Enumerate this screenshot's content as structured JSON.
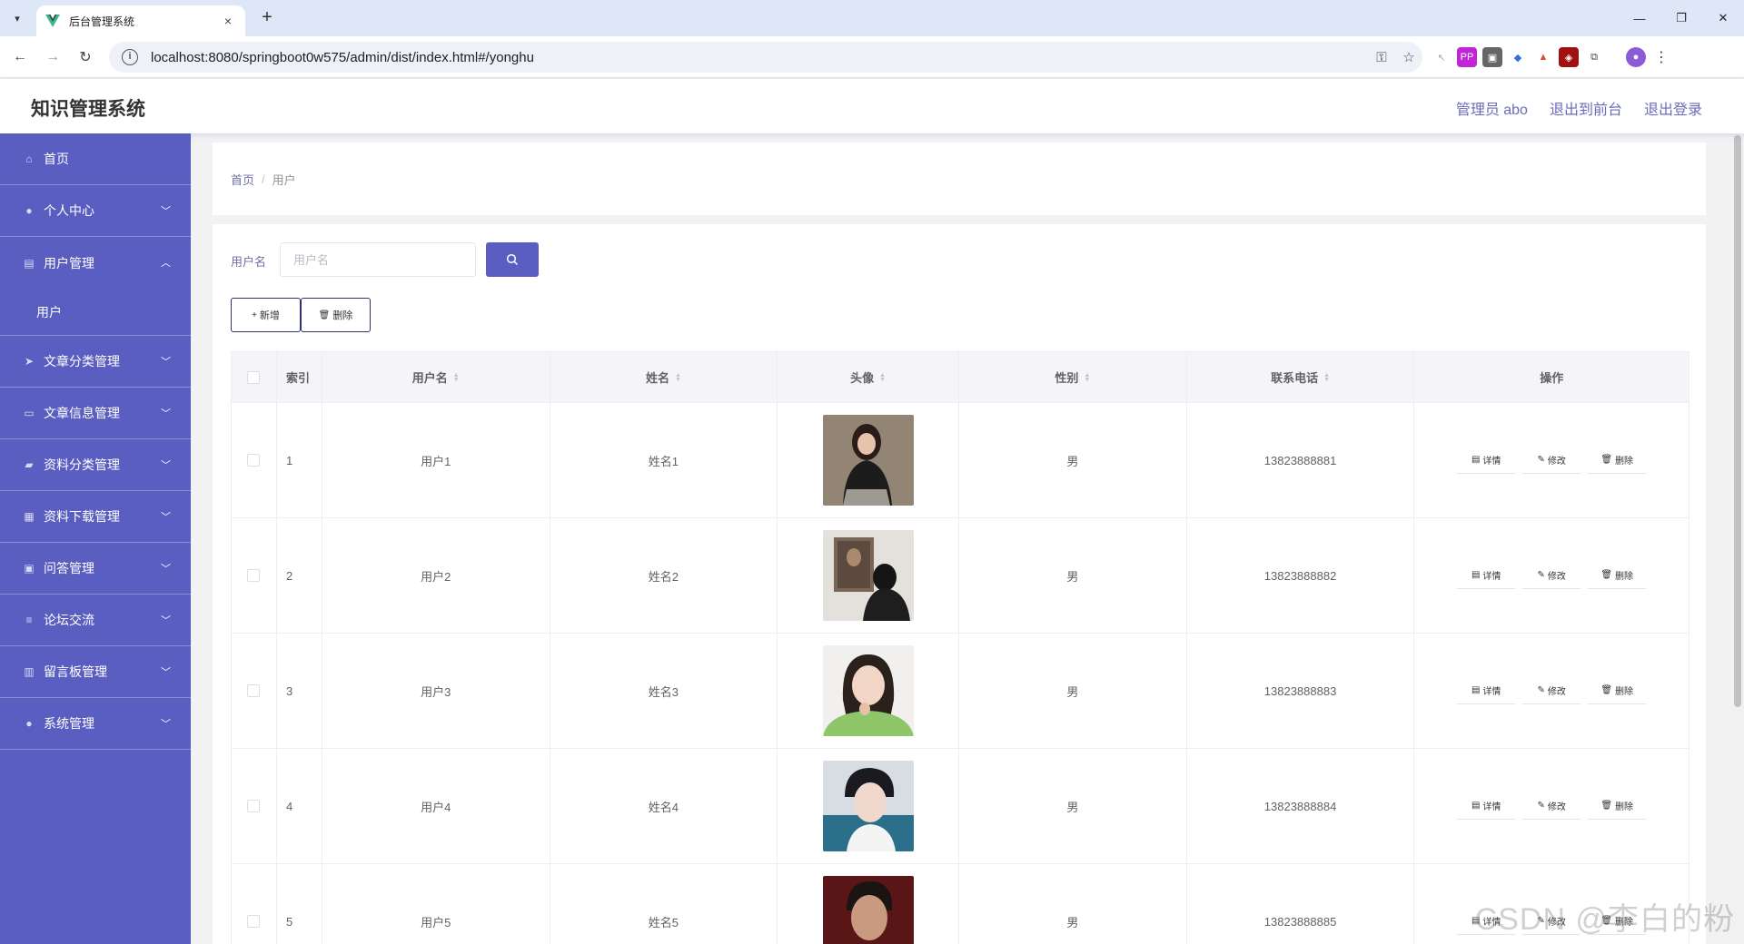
{
  "browser": {
    "tab_title": "后台管理系统",
    "tab_close": "×",
    "new_tab": "+",
    "url": "localhost:8080/springboot0w575/admin/dist/index.html#/yonghu",
    "minimize": "—",
    "restore": "❐",
    "close": "✕"
  },
  "header": {
    "title": "知识管理系统",
    "links": [
      "管理员 abo",
      "退出到前台",
      "退出登录"
    ]
  },
  "sidebar": {
    "items": [
      {
        "label": "首页",
        "icon": "home-icon",
        "glyph": "⌂",
        "expandable": false
      },
      {
        "label": "个人中心",
        "icon": "user-icon",
        "glyph": "●",
        "expandable": true,
        "expanded": false
      },
      {
        "label": "用户管理",
        "icon": "clipboard-icon",
        "glyph": "▤",
        "expandable": true,
        "expanded": true,
        "children": [
          "用户"
        ]
      },
      {
        "label": "文章分类管理",
        "icon": "send-icon",
        "glyph": "➤",
        "expandable": true,
        "expanded": false
      },
      {
        "label": "文章信息管理",
        "icon": "document-icon",
        "glyph": "▭",
        "expandable": true,
        "expanded": false
      },
      {
        "label": "资料分类管理",
        "icon": "suitcase-icon",
        "glyph": "▰",
        "expandable": true,
        "expanded": false
      },
      {
        "label": "资料下载管理",
        "icon": "grid-icon",
        "glyph": "▦",
        "expandable": true,
        "expanded": false
      },
      {
        "label": "问答管理",
        "icon": "check-square-icon",
        "glyph": "▣",
        "expandable": true,
        "expanded": false
      },
      {
        "label": "论坛交流",
        "icon": "list-icon",
        "glyph": "≡",
        "expandable": true,
        "expanded": false
      },
      {
        "label": "留言板管理",
        "icon": "bar-chart-icon",
        "glyph": "▥",
        "expandable": true,
        "expanded": false
      },
      {
        "label": "系统管理",
        "icon": "user-icon",
        "glyph": "●",
        "expandable": true,
        "expanded": false
      }
    ]
  },
  "breadcrumb": {
    "home": "首页",
    "separator": "/",
    "current": "用户"
  },
  "search": {
    "label": "用户名",
    "placeholder": "用户名"
  },
  "actions": {
    "add": "新增",
    "delete": "删除"
  },
  "table": {
    "headers": {
      "index": "索引",
      "username": "用户名",
      "name": "姓名",
      "avatar": "头像",
      "gender": "性别",
      "phone": "联系电话",
      "ops": "操作"
    },
    "rows": [
      {
        "index": "1",
        "username": "用户1",
        "name": "姓名1",
        "gender": "男",
        "phone": "13823888881"
      },
      {
        "index": "2",
        "username": "用户2",
        "name": "姓名2",
        "gender": "男",
        "phone": "13823888882"
      },
      {
        "index": "3",
        "username": "用户3",
        "name": "姓名3",
        "gender": "男",
        "phone": "13823888883"
      },
      {
        "index": "4",
        "username": "用户4",
        "name": "姓名4",
        "gender": "男",
        "phone": "13823888884"
      },
      {
        "index": "5",
        "username": "用户5",
        "name": "姓名5",
        "gender": "男",
        "phone": "13823888885"
      }
    ],
    "row_actions": {
      "detail": "详情",
      "edit": "修改",
      "delete": "删除"
    }
  },
  "watermark": "CSDN @李白的粉",
  "colors": {
    "accent": "#5a5ec0",
    "sidebar": "#5a5ec0",
    "header_link": "#6b6bb8"
  }
}
